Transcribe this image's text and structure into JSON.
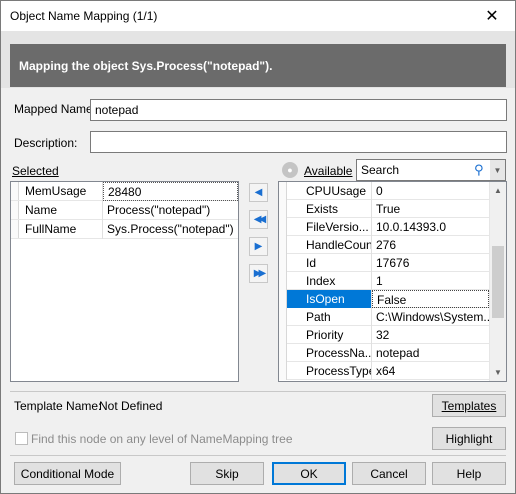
{
  "window": {
    "title": "Object Name Mapping (1/1)"
  },
  "header": {
    "text": "Mapping the object Sys.Process(\"notepad\")."
  },
  "mapped_name": {
    "label": "Mapped Name:",
    "value": "notepad"
  },
  "description": {
    "label": "Description:",
    "value": ""
  },
  "selected": {
    "label": "Selected",
    "rows": [
      {
        "name": "MemUsage",
        "value": "28480"
      },
      {
        "name": "Name",
        "value": "Process(\"notepad\")"
      },
      {
        "name": "FullName",
        "value": "Sys.Process(\"notepad\")"
      }
    ]
  },
  "available": {
    "label": "Available",
    "search_placeholder": "Search",
    "rows": [
      {
        "name": "CPUUsage",
        "value": "0"
      },
      {
        "name": "Exists",
        "value": "True"
      },
      {
        "name": "FileVersio...",
        "value": "10.0.14393.0"
      },
      {
        "name": "HandleCount",
        "value": "276"
      },
      {
        "name": "Id",
        "value": "17676"
      },
      {
        "name": "Index",
        "value": "1"
      },
      {
        "name": "IsOpen",
        "value": "False"
      },
      {
        "name": "Path",
        "value": "C:\\Windows\\System..."
      },
      {
        "name": "Priority",
        "value": "32"
      },
      {
        "name": "ProcessNa...",
        "value": "notepad"
      },
      {
        "name": "ProcessType",
        "value": "x64"
      }
    ],
    "selected_row": 6
  },
  "arrows": {
    "add_one": "◀",
    "add_all": "◀◀",
    "remove_one": "▶",
    "remove_all": "▶▶"
  },
  "template": {
    "label": "Template Name:",
    "value": "Not Defined",
    "button": "Templates"
  },
  "find_node": {
    "label": "Find this node on any level of NameMapping tree",
    "checked": false
  },
  "highlight_button": "Highlight",
  "buttons": {
    "conditional_mode": "Conditional Mode",
    "skip": "Skip",
    "ok": "OK",
    "cancel": "Cancel",
    "help": "Help"
  },
  "colors": {
    "header_bg": "#6b6b6b",
    "selection_bg": "#0078d7",
    "arrow_blue": "#1a6fd1"
  }
}
